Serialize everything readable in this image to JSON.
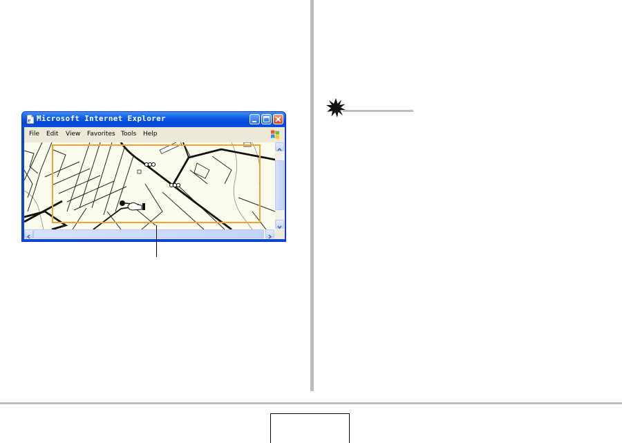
{
  "window": {
    "title": "Microsoft Internet Explorer",
    "icon": "ie-page-icon",
    "controls": [
      "minimize-icon",
      "maximize-icon",
      "close-icon"
    ]
  },
  "menu": {
    "items": [
      "File",
      "Edit",
      "View",
      "Favorites",
      "Tools",
      "Help"
    ],
    "logo": "windows-flag-icon"
  },
  "map": {
    "highlight_color": "#f0a32c",
    "background_color": "#fbfbee"
  },
  "notice": {
    "icon": "caution-burst-icon"
  },
  "colors": {
    "titlebar": "#0a58e0",
    "divider": "#bdbdbd",
    "menubar": "#ece9d8"
  }
}
